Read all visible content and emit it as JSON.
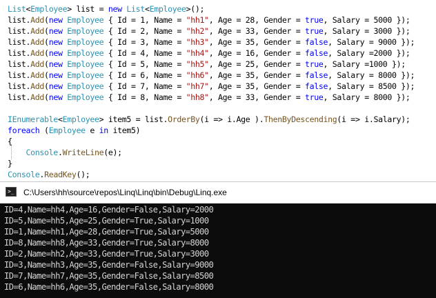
{
  "editor": {
    "lines": [
      [
        {
          "t": "type",
          "v": "List"
        },
        {
          "t": "plain",
          "v": "<"
        },
        {
          "t": "type",
          "v": "Employee"
        },
        {
          "t": "plain",
          "v": "> list = "
        },
        {
          "t": "kw",
          "v": "new"
        },
        {
          "t": "plain",
          "v": " "
        },
        {
          "t": "type",
          "v": "List"
        },
        {
          "t": "plain",
          "v": "<"
        },
        {
          "t": "type",
          "v": "Employee"
        },
        {
          "t": "plain",
          "v": ">();"
        }
      ],
      [
        {
          "t": "plain",
          "v": "list."
        },
        {
          "t": "method",
          "v": "Add"
        },
        {
          "t": "plain",
          "v": "("
        },
        {
          "t": "kw",
          "v": "new"
        },
        {
          "t": "plain",
          "v": " "
        },
        {
          "t": "type",
          "v": "Employee"
        },
        {
          "t": "plain",
          "v": " { Id = 1, Name = "
        },
        {
          "t": "str",
          "v": "\"hh1\""
        },
        {
          "t": "plain",
          "v": ", Age = 28, Gender = "
        },
        {
          "t": "kw",
          "v": "true"
        },
        {
          "t": "plain",
          "v": ", Salary = 5000 });"
        }
      ],
      [
        {
          "t": "plain",
          "v": "list."
        },
        {
          "t": "method",
          "v": "Add"
        },
        {
          "t": "plain",
          "v": "("
        },
        {
          "t": "kw",
          "v": "new"
        },
        {
          "t": "plain",
          "v": " "
        },
        {
          "t": "type",
          "v": "Employee"
        },
        {
          "t": "plain",
          "v": " { Id = 2, Name = "
        },
        {
          "t": "str",
          "v": "\"hh2\""
        },
        {
          "t": "plain",
          "v": ", Age = 33, Gender = "
        },
        {
          "t": "kw",
          "v": "true"
        },
        {
          "t": "plain",
          "v": ", Salary = 3000 });"
        }
      ],
      [
        {
          "t": "plain",
          "v": "list."
        },
        {
          "t": "method",
          "v": "Add"
        },
        {
          "t": "plain",
          "v": "("
        },
        {
          "t": "kw",
          "v": "new"
        },
        {
          "t": "plain",
          "v": " "
        },
        {
          "t": "type",
          "v": "Employee"
        },
        {
          "t": "plain",
          "v": " { Id = 3, Name = "
        },
        {
          "t": "str",
          "v": "\"hh3\""
        },
        {
          "t": "plain",
          "v": ", Age = 35, Gender = "
        },
        {
          "t": "kw",
          "v": "false"
        },
        {
          "t": "plain",
          "v": ", Salary = 9000 });"
        }
      ],
      [
        {
          "t": "plain",
          "v": "list."
        },
        {
          "t": "method",
          "v": "Add"
        },
        {
          "t": "plain",
          "v": "("
        },
        {
          "t": "kw",
          "v": "new"
        },
        {
          "t": "plain",
          "v": " "
        },
        {
          "t": "type",
          "v": "Employee"
        },
        {
          "t": "plain",
          "v": " { Id = 4, Name = "
        },
        {
          "t": "str",
          "v": "\"hh4\""
        },
        {
          "t": "plain",
          "v": ", Age = 16, Gender = "
        },
        {
          "t": "kw",
          "v": "false"
        },
        {
          "t": "plain",
          "v": ", Salary =2000 });"
        }
      ],
      [
        {
          "t": "plain",
          "v": "list."
        },
        {
          "t": "method",
          "v": "Add"
        },
        {
          "t": "plain",
          "v": "("
        },
        {
          "t": "kw",
          "v": "new"
        },
        {
          "t": "plain",
          "v": " "
        },
        {
          "t": "type",
          "v": "Employee"
        },
        {
          "t": "plain",
          "v": " { Id = 5, Name = "
        },
        {
          "t": "str",
          "v": "\"hh5\""
        },
        {
          "t": "plain",
          "v": ", Age = 25, Gender = "
        },
        {
          "t": "kw",
          "v": "true"
        },
        {
          "t": "plain",
          "v": ", Salary =1000 });"
        }
      ],
      [
        {
          "t": "plain",
          "v": "list."
        },
        {
          "t": "method",
          "v": "Add"
        },
        {
          "t": "plain",
          "v": "("
        },
        {
          "t": "kw",
          "v": "new"
        },
        {
          "t": "plain",
          "v": " "
        },
        {
          "t": "type",
          "v": "Employee"
        },
        {
          "t": "plain",
          "v": " { Id = 6, Name = "
        },
        {
          "t": "str",
          "v": "\"hh6\""
        },
        {
          "t": "plain",
          "v": ", Age = 35, Gender = "
        },
        {
          "t": "kw",
          "v": "false"
        },
        {
          "t": "plain",
          "v": ", Salary = 8000 });"
        }
      ],
      [
        {
          "t": "plain",
          "v": "list."
        },
        {
          "t": "method",
          "v": "Add"
        },
        {
          "t": "plain",
          "v": "("
        },
        {
          "t": "kw",
          "v": "new"
        },
        {
          "t": "plain",
          "v": " "
        },
        {
          "t": "type",
          "v": "Employee"
        },
        {
          "t": "plain",
          "v": " { Id = 7, Name = "
        },
        {
          "t": "str",
          "v": "\"hh7\""
        },
        {
          "t": "plain",
          "v": ", Age = 35, Gender = "
        },
        {
          "t": "kw",
          "v": "false"
        },
        {
          "t": "plain",
          "v": ", Salary = 8500 });"
        }
      ],
      [
        {
          "t": "plain",
          "v": "list."
        },
        {
          "t": "method",
          "v": "Add"
        },
        {
          "t": "plain",
          "v": "("
        },
        {
          "t": "kw",
          "v": "new"
        },
        {
          "t": "plain",
          "v": " "
        },
        {
          "t": "type",
          "v": "Employee"
        },
        {
          "t": "plain",
          "v": " { Id = 8, Name = "
        },
        {
          "t": "str",
          "v": "\"hh8\""
        },
        {
          "t": "plain",
          "v": ", Age = 33, Gender = "
        },
        {
          "t": "kw",
          "v": "true"
        },
        {
          "t": "plain",
          "v": ", Salary = 8000 });"
        }
      ],
      [],
      [
        {
          "t": "type",
          "v": "IEnumerable"
        },
        {
          "t": "plain",
          "v": "<"
        },
        {
          "t": "type",
          "v": "Employee"
        },
        {
          "t": "plain",
          "v": "> item5 = list."
        },
        {
          "t": "method",
          "v": "OrderBy"
        },
        {
          "t": "plain",
          "v": "(i => i.Age )."
        },
        {
          "t": "method",
          "v": "ThenByDescending"
        },
        {
          "t": "plain",
          "v": "(i => i.Salary);"
        }
      ],
      [
        {
          "t": "kw",
          "v": "foreach"
        },
        {
          "t": "plain",
          "v": " ("
        },
        {
          "t": "type",
          "v": "Employee"
        },
        {
          "t": "plain",
          "v": " e "
        },
        {
          "t": "kw",
          "v": "in"
        },
        {
          "t": "plain",
          "v": " item5)"
        }
      ],
      [
        {
          "t": "plain",
          "v": "{"
        }
      ],
      [
        {
          "t": "plain",
          "v": "    "
        },
        {
          "t": "type",
          "v": "Console"
        },
        {
          "t": "plain",
          "v": "."
        },
        {
          "t": "method",
          "v": "WriteLine"
        },
        {
          "t": "plain",
          "v": "(e);"
        }
      ],
      [
        {
          "t": "plain",
          "v": "}"
        }
      ],
      [
        {
          "t": "type",
          "v": "Console"
        },
        {
          "t": "plain",
          "v": "."
        },
        {
          "t": "method",
          "v": "ReadKey"
        },
        {
          "t": "plain",
          "v": "();"
        }
      ]
    ]
  },
  "console": {
    "title": "C:\\Users\\hh\\source\\repos\\Linq\\Linq\\bin\\Debug\\Linq.exe",
    "icon": "console-window-icon",
    "lines": [
      "ID=4,Name=hh4,Age=16,Gender=False,Salary=2000",
      "ID=5,Name=hh5,Age=25,Gender=True,Salary=1000",
      "ID=1,Name=hh1,Age=28,Gender=True,Salary=5000",
      "ID=8,Name=hh8,Age=33,Gender=True,Salary=8000",
      "ID=2,Name=hh2,Age=33,Gender=True,Salary=3000",
      "ID=3,Name=hh3,Age=35,Gender=False,Salary=9000",
      "ID=7,Name=hh7,Age=35,Gender=False,Salary=8500",
      "ID=6,Name=hh6,Age=35,Gender=False,Salary=8000"
    ]
  },
  "colors": {
    "type": "#2b91af",
    "keyword": "#0000ff",
    "string": "#a31515",
    "method": "#74531f",
    "console_bg": "#0c0c0c",
    "console_text": "#d4d4d4"
  }
}
